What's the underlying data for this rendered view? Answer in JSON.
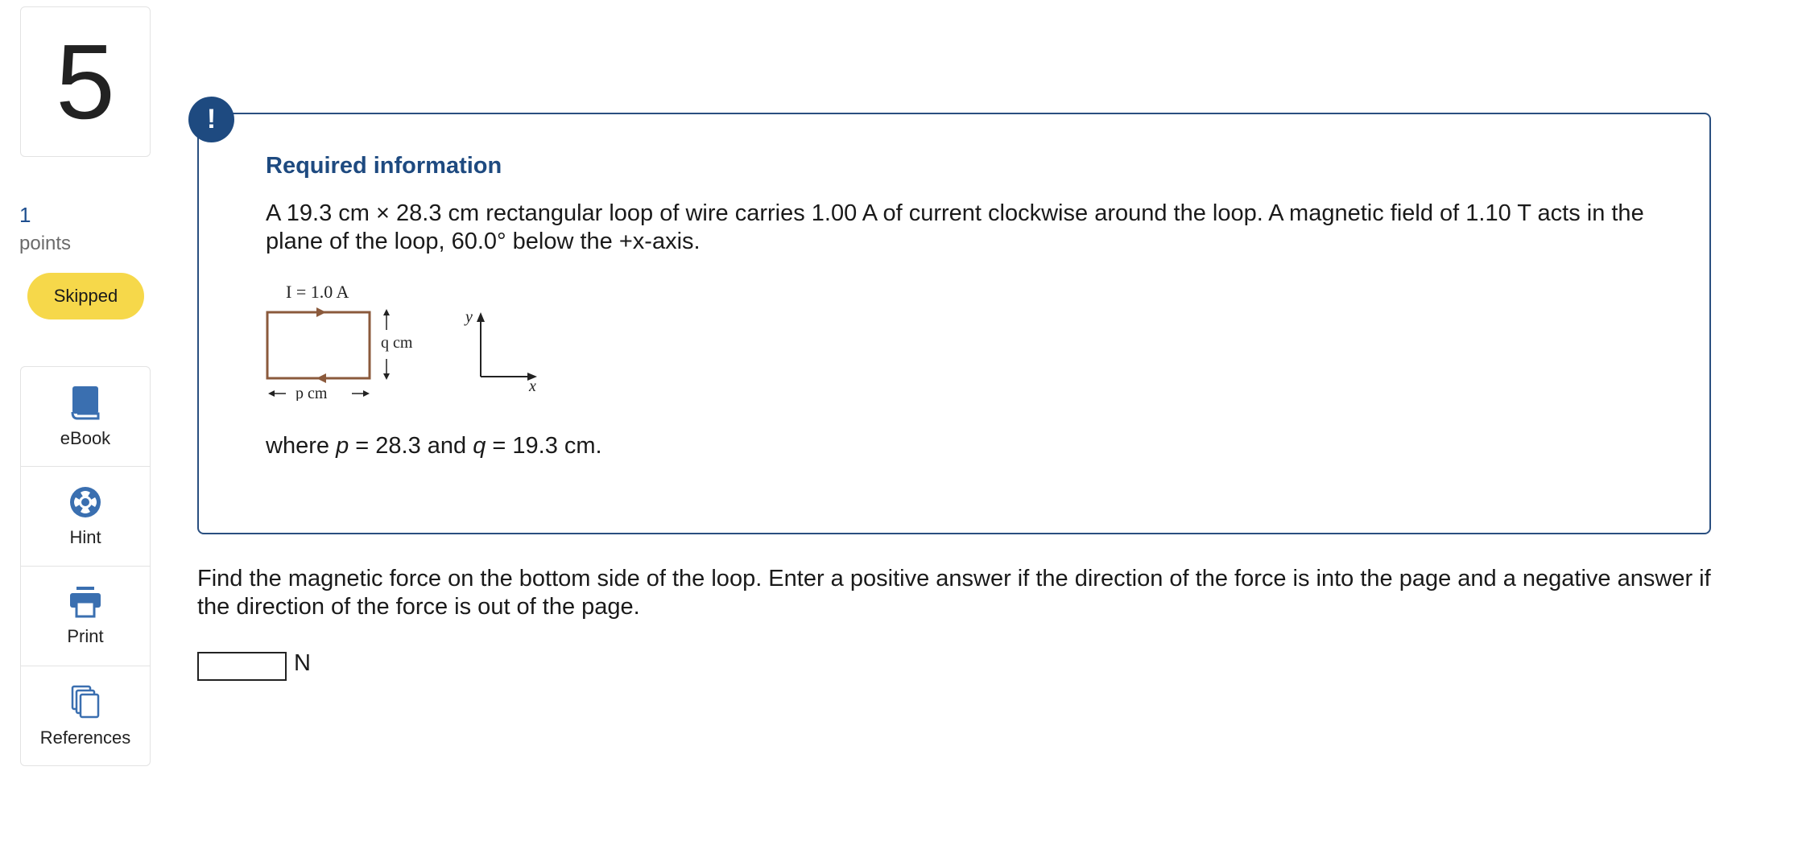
{
  "question": {
    "number": "5",
    "points_value": "1",
    "points_label": "points",
    "status": "Skipped"
  },
  "tools": {
    "ebook": "eBook",
    "hint": "Hint",
    "print": "Print",
    "references": "References"
  },
  "required": {
    "alert_symbol": "!",
    "title": "Required information",
    "text": "A 19.3 cm × 28.3 cm rectangular loop of wire carries 1.00 A of current clockwise around the loop. A magnetic field of 1.10 T acts in the plane of the loop, 60.0° below the +x-axis.",
    "where_prefix": "where",
    "p_var": "p",
    "p_val": " = 28.3 and ",
    "q_var": "q",
    "q_val": " = 19.3 cm."
  },
  "diagram": {
    "current_label": "I = 1.0 A",
    "height_label": "q cm",
    "width_label": "p cm",
    "y_axis": "y",
    "x_axis": "x"
  },
  "prompt": {
    "text": "Find the magnetic force on the bottom side of the loop. Enter a positive answer if the direction of the force is into the page and a negative answer if the direction of the force is out of the page.",
    "answer_value": "",
    "unit": "N"
  },
  "colors": {
    "accent": "#1e4a80",
    "skipped_badge": "#f6d84a",
    "icon_blue": "#3a6fb0",
    "loop_wire": "#8b5a3c"
  }
}
